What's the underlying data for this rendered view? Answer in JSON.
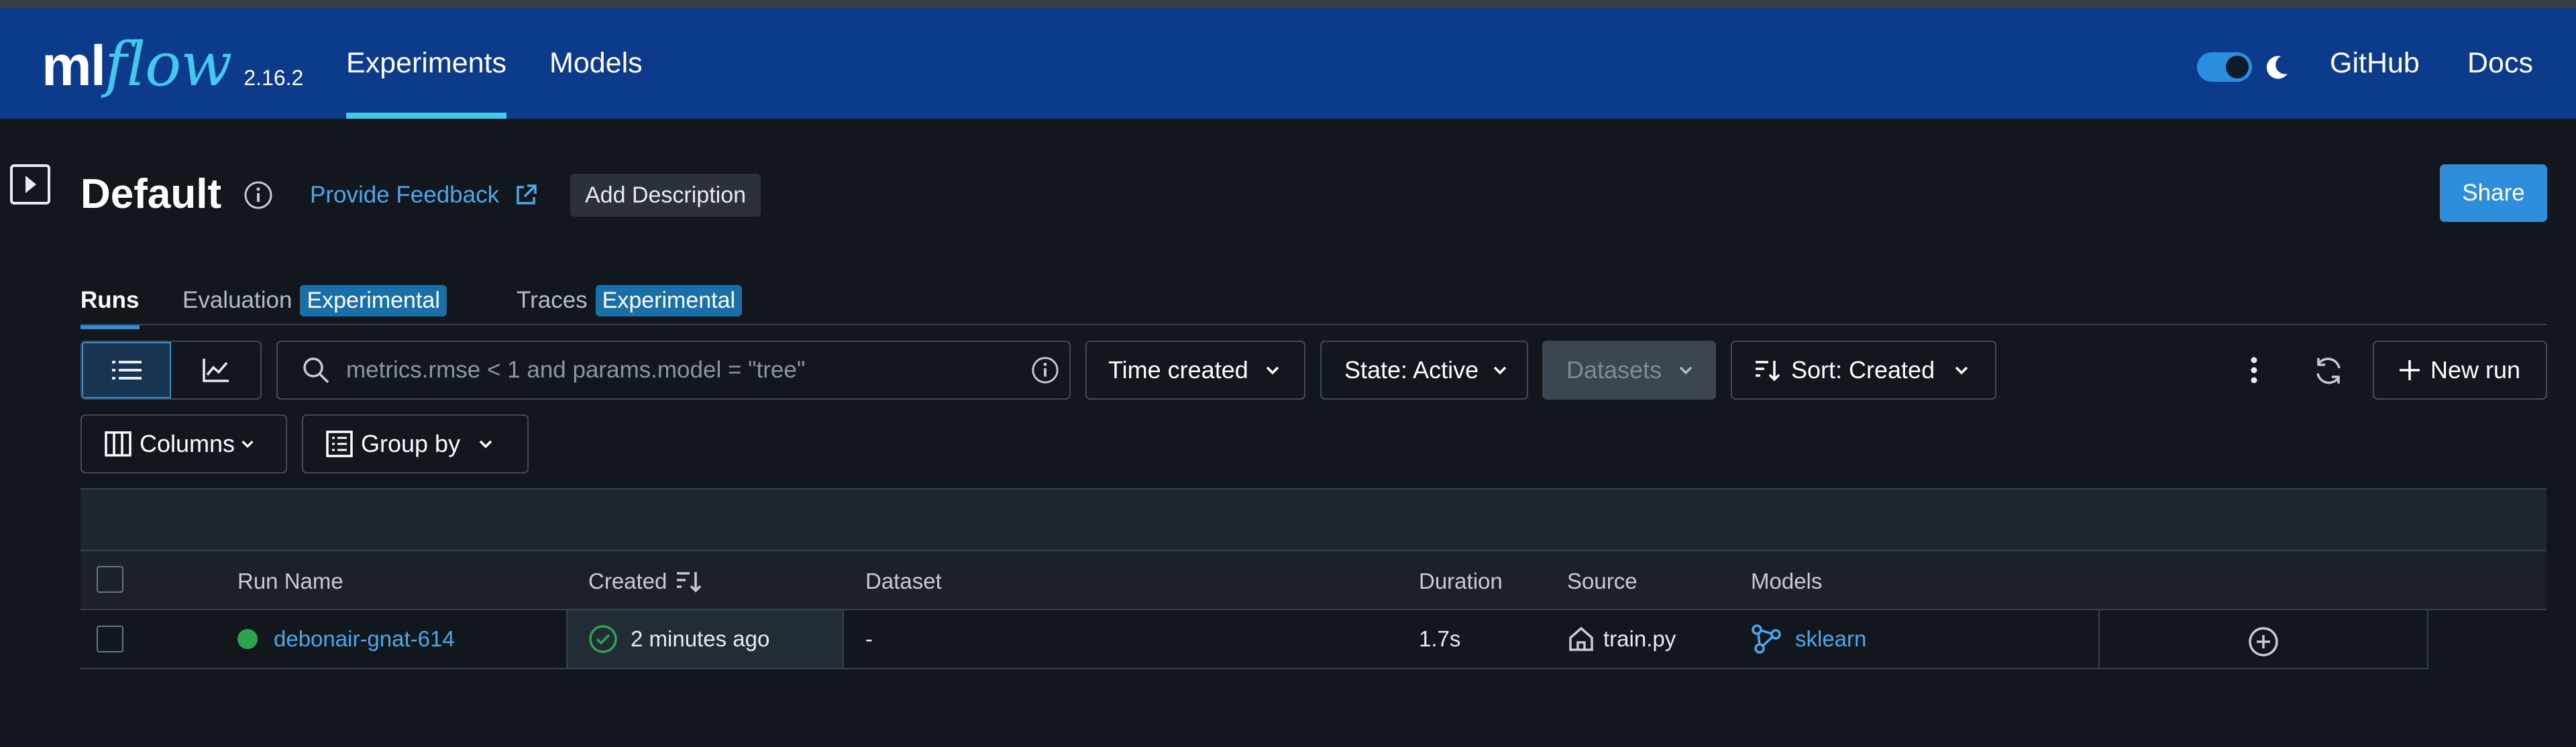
{
  "header": {
    "logo_ml": "ml",
    "logo_flow": "flow",
    "version": "2.16.2",
    "nav": [
      {
        "label": "Experiments",
        "active": true
      },
      {
        "label": "Models",
        "active": false
      }
    ],
    "dark_mode_on": true,
    "links": {
      "github": "GitHub",
      "docs": "Docs"
    }
  },
  "page": {
    "title": "Default",
    "feedback_label": "Provide Feedback",
    "add_description_label": "Add Description",
    "share_label": "Share"
  },
  "subtabs": [
    {
      "label": "Runs",
      "badge": "",
      "active": true
    },
    {
      "label": "Evaluation",
      "badge": "Experimental",
      "active": false
    },
    {
      "label": "Traces",
      "badge": "Experimental",
      "active": false
    }
  ],
  "toolbar": {
    "search_placeholder": "metrics.rmse < 1 and params.model = \"tree\"",
    "time_created_label": "Time created",
    "state_label": "State: Active",
    "datasets_label": "Datasets",
    "sort_label": "Sort: Created",
    "new_run_label": "New run",
    "columns_label": "Columns",
    "group_by_label": "Group by"
  },
  "table": {
    "columns": {
      "run_name": "Run Name",
      "created": "Created",
      "dataset": "Dataset",
      "duration": "Duration",
      "source": "Source",
      "models": "Models"
    },
    "rows": [
      {
        "run_name": "debonair-gnat-614",
        "created": "2 minutes ago",
        "dataset": "-",
        "duration": "1.7s",
        "source": "train.py",
        "models": "sklearn"
      }
    ]
  },
  "colors": {
    "header_bg": "#0d3b8c",
    "accent": "#43c9ed",
    "link": "#4aa8ef",
    "primary": "#2f8edb",
    "status_ok": "#2ba34f",
    "page_bg": "#11171c"
  }
}
